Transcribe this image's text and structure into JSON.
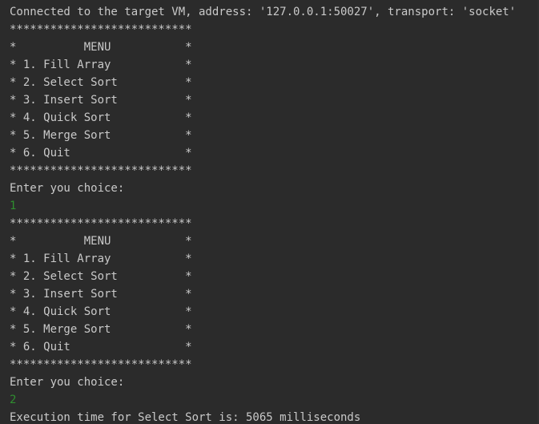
{
  "console": {
    "top_fragment": "   ...  ...      ..   ...   .     .         .       ",
    "lines": [
      {
        "text": "Connected to the target VM, address: '127.0.0.1:50027', transport: 'socket'",
        "kind": "output"
      },
      {
        "text": "***************************",
        "kind": "output"
      },
      {
        "text": "*          MENU           *",
        "kind": "output"
      },
      {
        "text": "* 1. Fill Array           *",
        "kind": "output"
      },
      {
        "text": "* 2. Select Sort          *",
        "kind": "output"
      },
      {
        "text": "* 3. Insert Sort          *",
        "kind": "output"
      },
      {
        "text": "* 4. Quick Sort           *",
        "kind": "output"
      },
      {
        "text": "* 5. Merge Sort           *",
        "kind": "output"
      },
      {
        "text": "* 6. Quit                 *",
        "kind": "output"
      },
      {
        "text": "***************************",
        "kind": "output"
      },
      {
        "text": "Enter you choice:",
        "kind": "output"
      },
      {
        "text": "1",
        "kind": "input"
      },
      {
        "text": "***************************",
        "kind": "output"
      },
      {
        "text": "*          MENU           *",
        "kind": "output"
      },
      {
        "text": "* 1. Fill Array           *",
        "kind": "output"
      },
      {
        "text": "* 2. Select Sort          *",
        "kind": "output"
      },
      {
        "text": "* 3. Insert Sort          *",
        "kind": "output"
      },
      {
        "text": "* 4. Quick Sort           *",
        "kind": "output"
      },
      {
        "text": "* 5. Merge Sort           *",
        "kind": "output"
      },
      {
        "text": "* 6. Quit                 *",
        "kind": "output"
      },
      {
        "text": "***************************",
        "kind": "output"
      },
      {
        "text": "Enter you choice:",
        "kind": "output"
      },
      {
        "text": "2",
        "kind": "input"
      },
      {
        "text": "Execution time for Select Sort is: 5065 milliseconds",
        "kind": "output"
      }
    ]
  },
  "colors": {
    "background": "#2b2b2b",
    "output_text": "#c9c9c9",
    "user_input_text": "#2f8e2f"
  }
}
